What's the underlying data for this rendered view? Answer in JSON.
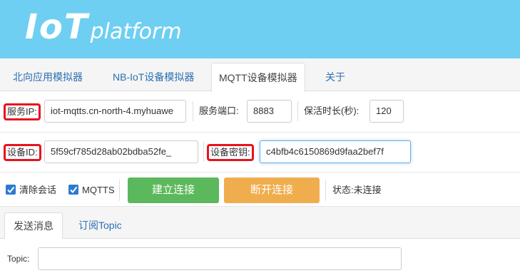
{
  "header": {
    "logo_main": "IoT",
    "logo_sub": "platform"
  },
  "tabs": [
    {
      "label": "北向应用模拟器"
    },
    {
      "label": "NB-IoT设备模拟器"
    },
    {
      "label": "MQTT设备模拟器",
      "active": true
    },
    {
      "label": "关于"
    }
  ],
  "connection": {
    "server_ip_label": "服务IP:",
    "server_ip_value": "iot-mqtts.cn-north-4.myhuawe",
    "port_label": "服务端口:",
    "port_value": "8883",
    "keepalive_label": "保活时长(秒):",
    "keepalive_value": "120",
    "device_id_label": "设备ID:",
    "device_id_value": "5f59cf785d28ab02bdba52fe_",
    "device_secret_label": "设备密钥:",
    "device_secret_value": "c4bfb4c6150869d9faa2bef7f"
  },
  "options": {
    "clean_session_label": "清除会话",
    "clean_session_checked": true,
    "mqtts_label": "MQTTS",
    "mqtts_checked": true,
    "connect_button": "建立连接",
    "disconnect_button": "断开连接",
    "status_text": "状态:未连接"
  },
  "subtabs": [
    {
      "label": "发送消息",
      "active": true
    },
    {
      "label": "订阅Topic"
    }
  ],
  "message": {
    "topic_label": "Topic:",
    "topic_value": ""
  },
  "colors": {
    "banner": "#6ecff2",
    "highlight_border": "#e8121e",
    "connect_button": "#5cb85c",
    "disconnect_button": "#f0ad4e",
    "checkbox": "#2a7bd1",
    "link": "#2a6fb0"
  }
}
